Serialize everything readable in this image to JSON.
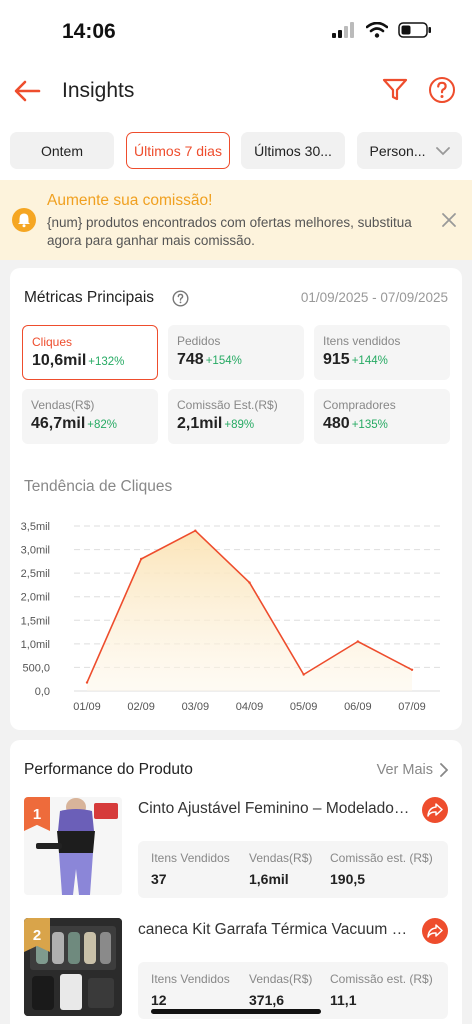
{
  "status_bar": {
    "time": "14:06"
  },
  "header": {
    "title": "Insights",
    "back_icon": "arrow-left-icon",
    "filter_icon": "funnel-icon",
    "help_icon": "question-circle-icon"
  },
  "tabs": [
    {
      "label": "Ontem",
      "active": false
    },
    {
      "label": "Últimos 7 dias",
      "active": true
    },
    {
      "label": "Últimos 30...",
      "active": false
    },
    {
      "label": "Person...",
      "active": false
    }
  ],
  "banner": {
    "title": "Aumente sua comissão!",
    "text": "{num} produtos encontrados com ofertas melhores, substitua agora para ganhar mais comissão."
  },
  "metrics": {
    "title": "Métricas Principais",
    "date_range": "01/09/2025 - 07/09/2025",
    "items": [
      {
        "label": "Cliques",
        "value": "10,6mil",
        "change": "+132%",
        "active": true
      },
      {
        "label": "Pedidos",
        "value": "748",
        "change": "+154%",
        "active": false
      },
      {
        "label": "Itens vendidos",
        "value": "915",
        "change": "+144%",
        "active": false
      },
      {
        "label": "Vendas(R$)",
        "value": "46,7mil",
        "change": "+82%",
        "active": false
      },
      {
        "label": "Comissão Est.(R$)",
        "value": "2,1mil",
        "change": "+89%",
        "active": false
      },
      {
        "label": "Compradores",
        "value": "480",
        "change": "+135%",
        "active": false
      }
    ]
  },
  "chart_data": {
    "type": "area",
    "title": "Tendência de Cliques",
    "categories": [
      "01/09",
      "02/09",
      "03/09",
      "04/09",
      "05/09",
      "06/09",
      "07/09"
    ],
    "values": [
      180,
      2800,
      3400,
      2300,
      350,
      1050,
      450
    ],
    "y_ticks": [
      "0,0",
      "500,0",
      "1,0mil",
      "1,5mil",
      "2,0mil",
      "2,5mil",
      "3,0mil",
      "3,5mil"
    ],
    "ylim": [
      0,
      3500
    ],
    "grid": true,
    "color": "#ee4d2d"
  },
  "performance": {
    "title": "Performance do Produto",
    "see_more": "Ver Mais",
    "labels": {
      "items_sold": "Itens Vendidos",
      "sales": "Vendas(R$)",
      "commission": "Comissão est. (R$)"
    },
    "products": [
      {
        "rank": "1",
        "name": "Cinto Ajustável Feminino – Modelador Cintura Fina",
        "items_sold": "37",
        "sales": "1,6mil",
        "commission": "190,5"
      },
      {
        "rank": "2",
        "name": "caneca Kit Garrafa Térmica Vacuum Flask Set",
        "items_sold": "12",
        "sales": "371,6",
        "commission": "11,1"
      }
    ]
  },
  "colors": {
    "accent": "#ee4d2d",
    "positive": "#26aa63",
    "banner_bg": "#fdf3dc",
    "banner_title": "#f0a020"
  }
}
